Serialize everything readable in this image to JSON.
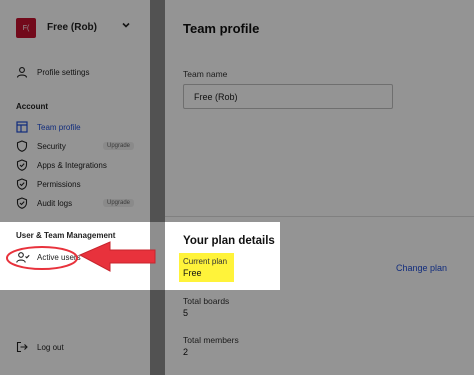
{
  "sidebar": {
    "team_badge": "F(",
    "team_name": "Free (Rob)",
    "profile_settings": "Profile settings",
    "account_heading": "Account",
    "items": [
      {
        "label": "Team profile",
        "icon": "layout-icon",
        "badge": ""
      },
      {
        "label": "Security",
        "icon": "shield-icon",
        "badge": "Upgrade"
      },
      {
        "label": "Apps & Integrations",
        "icon": "shield-check-icon",
        "badge": ""
      },
      {
        "label": "Permissions",
        "icon": "shield-check-icon",
        "badge": ""
      },
      {
        "label": "Audit logs",
        "icon": "shield-check-icon",
        "badge": "Upgrade"
      }
    ],
    "user_mgmt_heading": "User & Team Management",
    "active_users": "Active users",
    "logout": "Log out"
  },
  "main": {
    "title": "Team profile",
    "team_name_label": "Team name",
    "team_name_value": "Free (Rob)",
    "plan_heading": "Your plan details",
    "current_plan_label": "Current plan",
    "current_plan_value": "Free",
    "change_plan": "Change plan",
    "total_boards_label": "Total boards",
    "total_boards_value": "5",
    "total_members_label": "Total members",
    "total_members_value": "2"
  },
  "colors": {
    "accent": "#1f4ed8",
    "badge": "#c4122f",
    "highlight": "#fff33a",
    "arrow": "#e8323c"
  }
}
